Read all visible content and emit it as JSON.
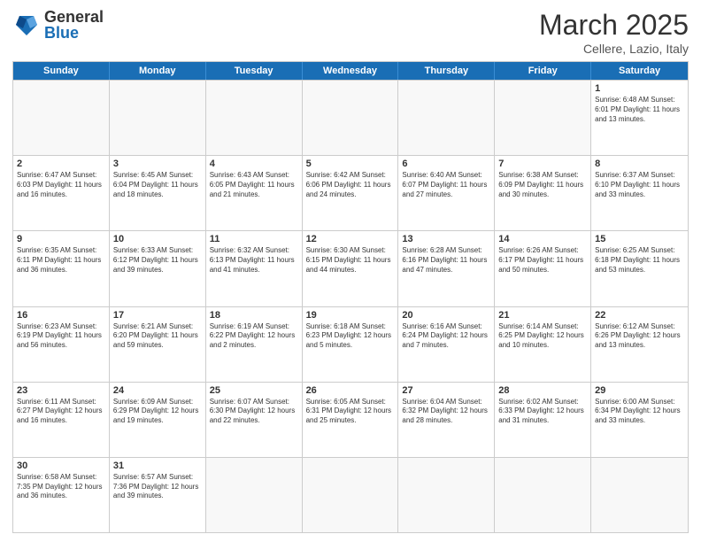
{
  "header": {
    "logo_general": "General",
    "logo_blue": "Blue",
    "title": "March 2025",
    "location": "Cellere, Lazio, Italy"
  },
  "weekdays": [
    "Sunday",
    "Monday",
    "Tuesday",
    "Wednesday",
    "Thursday",
    "Friday",
    "Saturday"
  ],
  "rows": [
    [
      {
        "day": "",
        "info": ""
      },
      {
        "day": "",
        "info": ""
      },
      {
        "day": "",
        "info": ""
      },
      {
        "day": "",
        "info": ""
      },
      {
        "day": "",
        "info": ""
      },
      {
        "day": "",
        "info": ""
      },
      {
        "day": "1",
        "info": "Sunrise: 6:48 AM\nSunset: 6:01 PM\nDaylight: 11 hours\nand 13 minutes."
      }
    ],
    [
      {
        "day": "2",
        "info": "Sunrise: 6:47 AM\nSunset: 6:03 PM\nDaylight: 11 hours\nand 16 minutes."
      },
      {
        "day": "3",
        "info": "Sunrise: 6:45 AM\nSunset: 6:04 PM\nDaylight: 11 hours\nand 18 minutes."
      },
      {
        "day": "4",
        "info": "Sunrise: 6:43 AM\nSunset: 6:05 PM\nDaylight: 11 hours\nand 21 minutes."
      },
      {
        "day": "5",
        "info": "Sunrise: 6:42 AM\nSunset: 6:06 PM\nDaylight: 11 hours\nand 24 minutes."
      },
      {
        "day": "6",
        "info": "Sunrise: 6:40 AM\nSunset: 6:07 PM\nDaylight: 11 hours\nand 27 minutes."
      },
      {
        "day": "7",
        "info": "Sunrise: 6:38 AM\nSunset: 6:09 PM\nDaylight: 11 hours\nand 30 minutes."
      },
      {
        "day": "8",
        "info": "Sunrise: 6:37 AM\nSunset: 6:10 PM\nDaylight: 11 hours\nand 33 minutes."
      }
    ],
    [
      {
        "day": "9",
        "info": "Sunrise: 6:35 AM\nSunset: 6:11 PM\nDaylight: 11 hours\nand 36 minutes."
      },
      {
        "day": "10",
        "info": "Sunrise: 6:33 AM\nSunset: 6:12 PM\nDaylight: 11 hours\nand 39 minutes."
      },
      {
        "day": "11",
        "info": "Sunrise: 6:32 AM\nSunset: 6:13 PM\nDaylight: 11 hours\nand 41 minutes."
      },
      {
        "day": "12",
        "info": "Sunrise: 6:30 AM\nSunset: 6:15 PM\nDaylight: 11 hours\nand 44 minutes."
      },
      {
        "day": "13",
        "info": "Sunrise: 6:28 AM\nSunset: 6:16 PM\nDaylight: 11 hours\nand 47 minutes."
      },
      {
        "day": "14",
        "info": "Sunrise: 6:26 AM\nSunset: 6:17 PM\nDaylight: 11 hours\nand 50 minutes."
      },
      {
        "day": "15",
        "info": "Sunrise: 6:25 AM\nSunset: 6:18 PM\nDaylight: 11 hours\nand 53 minutes."
      }
    ],
    [
      {
        "day": "16",
        "info": "Sunrise: 6:23 AM\nSunset: 6:19 PM\nDaylight: 11 hours\nand 56 minutes."
      },
      {
        "day": "17",
        "info": "Sunrise: 6:21 AM\nSunset: 6:20 PM\nDaylight: 11 hours\nand 59 minutes."
      },
      {
        "day": "18",
        "info": "Sunrise: 6:19 AM\nSunset: 6:22 PM\nDaylight: 12 hours\nand 2 minutes."
      },
      {
        "day": "19",
        "info": "Sunrise: 6:18 AM\nSunset: 6:23 PM\nDaylight: 12 hours\nand 5 minutes."
      },
      {
        "day": "20",
        "info": "Sunrise: 6:16 AM\nSunset: 6:24 PM\nDaylight: 12 hours\nand 7 minutes."
      },
      {
        "day": "21",
        "info": "Sunrise: 6:14 AM\nSunset: 6:25 PM\nDaylight: 12 hours\nand 10 minutes."
      },
      {
        "day": "22",
        "info": "Sunrise: 6:12 AM\nSunset: 6:26 PM\nDaylight: 12 hours\nand 13 minutes."
      }
    ],
    [
      {
        "day": "23",
        "info": "Sunrise: 6:11 AM\nSunset: 6:27 PM\nDaylight: 12 hours\nand 16 minutes."
      },
      {
        "day": "24",
        "info": "Sunrise: 6:09 AM\nSunset: 6:29 PM\nDaylight: 12 hours\nand 19 minutes."
      },
      {
        "day": "25",
        "info": "Sunrise: 6:07 AM\nSunset: 6:30 PM\nDaylight: 12 hours\nand 22 minutes."
      },
      {
        "day": "26",
        "info": "Sunrise: 6:05 AM\nSunset: 6:31 PM\nDaylight: 12 hours\nand 25 minutes."
      },
      {
        "day": "27",
        "info": "Sunrise: 6:04 AM\nSunset: 6:32 PM\nDaylight: 12 hours\nand 28 minutes."
      },
      {
        "day": "28",
        "info": "Sunrise: 6:02 AM\nSunset: 6:33 PM\nDaylight: 12 hours\nand 31 minutes."
      },
      {
        "day": "29",
        "info": "Sunrise: 6:00 AM\nSunset: 6:34 PM\nDaylight: 12 hours\nand 33 minutes."
      }
    ],
    [
      {
        "day": "30",
        "info": "Sunrise: 6:58 AM\nSunset: 7:35 PM\nDaylight: 12 hours\nand 36 minutes."
      },
      {
        "day": "31",
        "info": "Sunrise: 6:57 AM\nSunset: 7:36 PM\nDaylight: 12 hours\nand 39 minutes."
      },
      {
        "day": "",
        "info": ""
      },
      {
        "day": "",
        "info": ""
      },
      {
        "day": "",
        "info": ""
      },
      {
        "day": "",
        "info": ""
      },
      {
        "day": "",
        "info": ""
      }
    ]
  ]
}
